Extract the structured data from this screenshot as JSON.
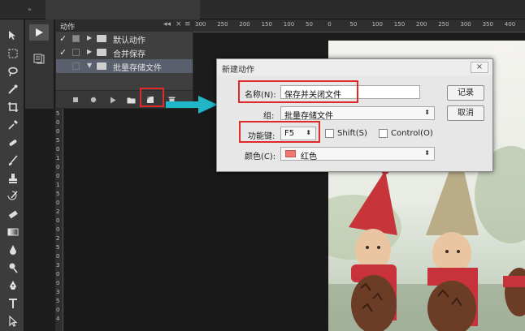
{
  "app": {
    "top_strip_icon": "»"
  },
  "actions_panel": {
    "title": "动作",
    "header_controls": [
      "◂◂",
      "×",
      "≡"
    ],
    "items": [
      {
        "label": "默认动作",
        "checked": true,
        "expanded": false,
        "selected": false
      },
      {
        "label": "合并保存",
        "checked": true,
        "expanded": false,
        "selected": false
      },
      {
        "label": "批量存储文件",
        "checked": false,
        "expanded": true,
        "selected": true
      }
    ],
    "footer_buttons": [
      "stop-icon",
      "record-icon",
      "play-icon",
      "folder-icon",
      "new-action-icon",
      "trash-icon"
    ]
  },
  "ruler": {
    "top_ticks": [
      "300",
      "250",
      "200",
      "150",
      "100",
      "50",
      "0",
      "50",
      "100",
      "150",
      "200",
      "250",
      "300",
      "350",
      "400"
    ],
    "left_ticks": [
      "5",
      "0",
      "0",
      "5",
      "0",
      "1",
      "0",
      "0",
      "1",
      "5",
      "0",
      "2",
      "0",
      "0",
      "2",
      "5",
      "0",
      "3",
      "0",
      "0",
      "3",
      "5",
      "0",
      "4"
    ]
  },
  "dialog": {
    "title": "新建动作",
    "close_label": "×",
    "name_label": "名称(N):",
    "name_value": "保存并关闭文件",
    "set_label": "组:",
    "set_value": "批量存储文件",
    "function_key_label": "功能键:",
    "function_key_value": "F5",
    "shift_label": "Shift(S)",
    "control_label": "Control(O)",
    "color_label": "颜色(C):",
    "color_value": "红色",
    "color_swatch": "#ef7772",
    "record_button": "记录",
    "cancel_button": "取消"
  },
  "colors": {
    "highlight_box": "#e02a2a",
    "arrow": "#1fb6c8",
    "panel_selected": "#5a5f6d"
  }
}
